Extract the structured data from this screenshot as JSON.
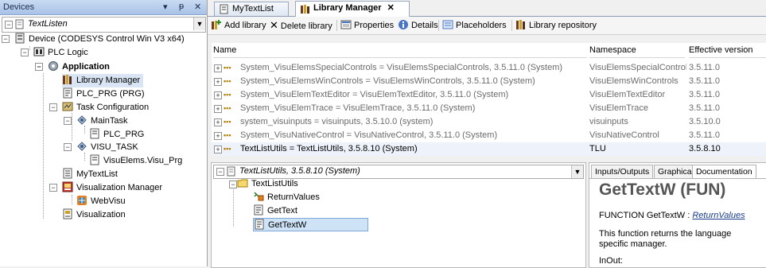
{
  "devices_panel": {
    "title": "Devices",
    "controls": [
      "▾",
      "ᵽ",
      "✕"
    ],
    "combo_value": "TextListen",
    "tree": [
      {
        "label": "Device (CODESYS Control Win V3 x64)"
      },
      {
        "label": "PLC Logic"
      },
      {
        "label": "Application"
      },
      {
        "label": "Library Manager"
      },
      {
        "label": "PLC_PRG (PRG)"
      },
      {
        "label": "Task Configuration"
      },
      {
        "label": "MainTask"
      },
      {
        "label": "PLC_PRG"
      },
      {
        "label": "VISU_TASK"
      },
      {
        "label": "VisuElems.Visu_Prg"
      },
      {
        "label": "MyTextList"
      },
      {
        "label": "Visualization Manager"
      },
      {
        "label": "WebVisu"
      },
      {
        "label": "Visualization"
      }
    ]
  },
  "tabs": [
    {
      "label": "MyTextList"
    },
    {
      "label": "Library Manager",
      "close": "✕"
    }
  ],
  "toolbar": {
    "add_library": "Add library",
    "delete_library": "Delete library",
    "properties": "Properties",
    "details": "Details",
    "placeholders": "Placeholders",
    "library_repository": "Library repository"
  },
  "library_table": {
    "columns": [
      "Name",
      "Namespace",
      "Effective version"
    ],
    "rows": [
      {
        "name": "System_VisuElemsSpecialControls = VisuElemsSpecialControls, 3.5.11.0 (System)",
        "namespace": "VisuElemsSpecialControls",
        "version": "3.5.11.0"
      },
      {
        "name": "System_VisuElemsWinControls = VisuElemsWinControls, 3.5.11.0 (System)",
        "namespace": "VisuElemsWinControls",
        "version": "3.5.11.0"
      },
      {
        "name": "System_VisuElemTextEditor = VisuElemTextEditor, 3.5.11.0 (System)",
        "namespace": "VisuElemTextEditor",
        "version": "3.5.11.0"
      },
      {
        "name": "System_VisuElemTrace = VisuElemTrace, 3.5.11.0 (System)",
        "namespace": "VisuElemTrace",
        "version": "3.5.11.0"
      },
      {
        "name": "system_visuinputs = visuinputs, 3.5.10.0 (system)",
        "namespace": "visuinputs",
        "version": "3.5.10.0"
      },
      {
        "name": "System_VisuNativeControl = VisuNativeControl, 3.5.11.0 (System)",
        "namespace": "VisuNativeControl",
        "version": "3.5.11.0"
      },
      {
        "name": "TextListUtils = TextListUtils, 3.5.8.10 (System)",
        "namespace": "TLU",
        "version": "3.5.8.10"
      }
    ]
  },
  "lib_browser": {
    "combo_value": "TextListUtils, 3.5.8.10 (System)",
    "tree": [
      {
        "label": "TextListUtils"
      },
      {
        "label": "ReturnValues"
      },
      {
        "label": "GetText"
      },
      {
        "label": "GetTextW"
      }
    ]
  },
  "doc_panel": {
    "tabs": [
      "Inputs/Outputs",
      "Graphical",
      "Documentation"
    ],
    "heading": "GetTextW (FUN)",
    "signature_prefix": "FUNCTION GetTextW : ",
    "signature_type": "ReturnValues",
    "description": "This function returns the language specific manager.",
    "inout_label": "InOut:"
  }
}
